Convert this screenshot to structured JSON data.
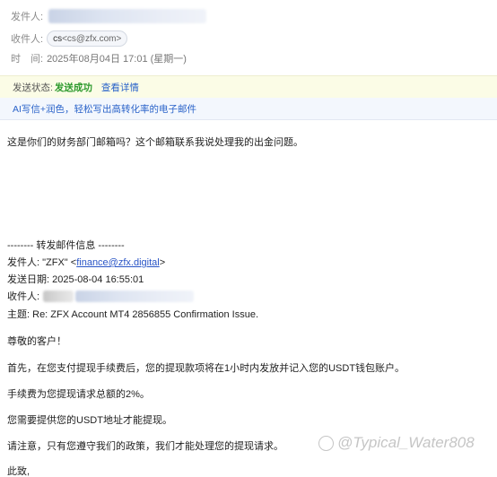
{
  "header": {
    "from_label": "发件人:",
    "to_label": "收件人:",
    "to_chip_name": "cs",
    "to_chip_addr": "<cs@zfx.com>",
    "time_label": "时　间:",
    "time_value": "2025年08月04日 17:01 (星期一)"
  },
  "status": {
    "label": "发送状态:",
    "value": "发送成功",
    "details_link": "查看详情"
  },
  "ai_bar": {
    "text": "AI写信+润色，轻松写出高转化率的电子邮件"
  },
  "body": {
    "question": "这是你们的财务部门邮箱吗？这个邮箱联系我说处理我的出金问题。",
    "forward_header": "-------- 转发邮件信息 --------",
    "fwd_from_label": "发件人:",
    "fwd_from_name": "\"ZFX\" <",
    "fwd_from_email": "finance@zfx.digital",
    "fwd_from_close": ">",
    "fwd_date_label": "发送日期:",
    "fwd_date_value": "2025-08-04 16:55:01",
    "fwd_to_label": "收件人:",
    "fwd_subject_label": "主题:",
    "fwd_subject_value": "Re: ZFX Account MT4 2856855 Confirmation Issue.",
    "greeting": "尊敬的客户！",
    "para1": "首先，在您支付提现手续费后，您的提现款项将在1小时内发放并记入您的USDT钱包账户。",
    "para2": "手续费为您提现请求总额的2%。",
    "para3": "您需要提供您的USDT地址才能提现。",
    "para4": "请注意，只有您遵守我们的政策，我们才能处理您的提现请求。",
    "closing": "此致,"
  },
  "watermark": {
    "text": "@Typical_Water808"
  }
}
